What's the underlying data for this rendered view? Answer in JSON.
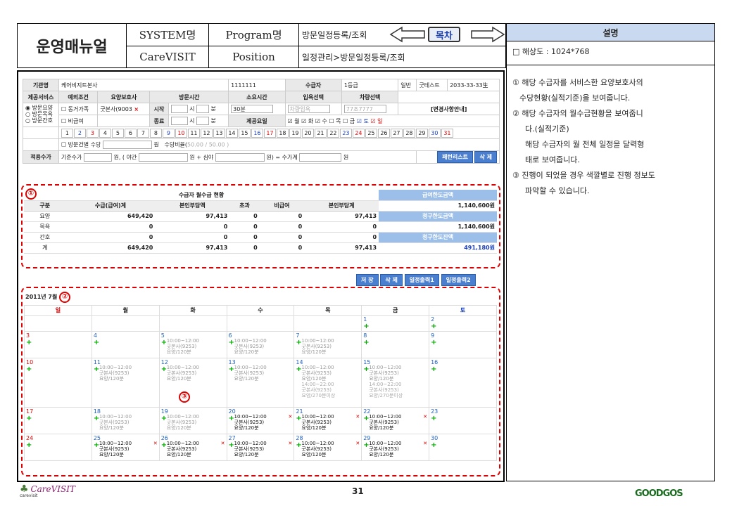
{
  "header": {
    "manual_title": "운영매뉴얼",
    "system_label": "SYSTEM명",
    "system_value": "CareVISIT",
    "program_label": "Program명",
    "program_value": "방문일정등록/조회",
    "position_label": "Position",
    "position_value": "일정관리>방문일정등록/조회",
    "toc_label": "목차"
  },
  "description": {
    "title": "설명",
    "resolution": "□ 해상도 : 1024*768",
    "items": [
      "① 해당 수급자를 서비스한 요양보호사의",
      "수당현황(실적기준)을 보여줍니다.",
      "② 해당 수급자의 월수급현황을 보여줍니",
      "다.(실적기준)",
      "해당 수급자의 월 전체 일정을 달력형",
      "태로 보여줍니다.",
      "③ 진행이 되었을 경우 색깔별로 진행 정보도",
      "파악할 수 있습니다."
    ]
  },
  "form": {
    "agency_label": "기관명",
    "agency_value": "케어비지트본사",
    "agency_code": "1111111",
    "recipient_label": "수급자",
    "grade": "1등급",
    "type": "일반",
    "test_name": "굿테스트",
    "test_id": "2033-33-33生",
    "service_label": "제공서비스",
    "exception_label": "예외조건",
    "caregiver_label": "요양보호사",
    "visit_time_label": "방문시간",
    "duration_label": "소요시간",
    "entry_label": "입욕선택",
    "vehicle_label": "차량선택",
    "svc_options": [
      "방문요양",
      "방문목욕",
      "방문간호"
    ],
    "family_label": "동거가족",
    "caregiver_value": "굿본사(9003",
    "start_label": "시작",
    "end_label": "종료",
    "hour_label": "시",
    "min_label": "분",
    "duration_value": "30분",
    "entry_value": "차량입욕",
    "vehicle_value": "77조7777",
    "change_label": "[변경사항안내]",
    "nonpay_label": "비급여",
    "weekday_label": "제공요일",
    "weekdays": [
      "월",
      "화",
      "수",
      "목",
      "금",
      "토",
      "일"
    ],
    "days": [
      "1",
      "2",
      "3",
      "4",
      "5",
      "6",
      "7",
      "8",
      "9",
      "10",
      "11",
      "12",
      "13",
      "14",
      "15",
      "16",
      "17",
      "18",
      "19",
      "20",
      "21",
      "22",
      "23",
      "24",
      "25",
      "26",
      "27",
      "28",
      "29",
      "30",
      "31"
    ],
    "bath_fee_label": "방문건별 수당",
    "won": "원",
    "fee_ratio_label": "수당비율(",
    "fee_ratio_value": "50.00 / 50.00 )",
    "apply_label": "적용수가",
    "base_label": "기준수가",
    "night_label": "원, ( 야간",
    "deep_label": "원 + 심야",
    "total_label": "원) = 수가계",
    "won2": "원",
    "pattern_btn": "패턴리스트",
    "delete_btn": "삭 제"
  },
  "summary": {
    "title": "수급자 월수급 현황",
    "limit_label": "급여한도금액",
    "limit_value": "1,140,600원",
    "claim_label": "청구한도금액",
    "claim_value": "1,140,600원",
    "remain_label": "청구한도잔액",
    "remain_value": "491,180원",
    "columns": [
      "구분",
      "수급(급여)계",
      "본인부담액",
      "초과",
      "비급여",
      "본인부담계"
    ],
    "rows": [
      [
        "요양",
        "649,420",
        "97,413",
        "0",
        "0",
        "97,413"
      ],
      [
        "목욕",
        "0",
        "0",
        "0",
        "0",
        "0"
      ],
      [
        "간호",
        "0",
        "0",
        "0",
        "0",
        "0"
      ],
      [
        "계",
        "649,420",
        "97,413",
        "0",
        "0",
        "97,413"
      ]
    ]
  },
  "actions": [
    "저 장",
    "삭 제",
    "일정출력1",
    "일정출력2"
  ],
  "calendar": {
    "month_label": "2011년 7월",
    "weekdays": [
      "일",
      "월",
      "화",
      "수",
      "목",
      "금",
      "토"
    ],
    "schedule_time": "10:00~12:00",
    "schedule_person": "굿본사(9253)",
    "schedule_type": "요양/120분",
    "extra_time": "14:00~22:00",
    "extra_type": "요양/270분이상"
  },
  "annotations": [
    "①",
    "②",
    "③"
  ],
  "footer": {
    "page": "31",
    "logo_left": "CareVISIT",
    "logo_left_sub": "carevisit",
    "logo_right": "GOODGOS"
  }
}
